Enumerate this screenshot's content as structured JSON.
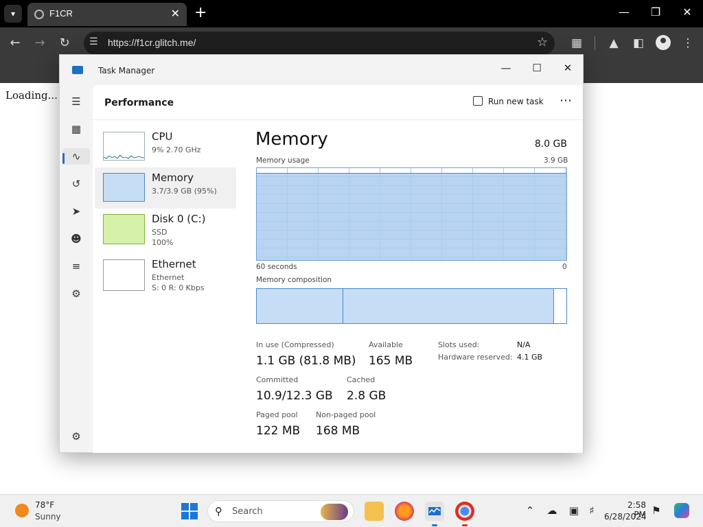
{
  "browser": {
    "tab_title": "F1CR",
    "url": "https://f1cr.glitch.me/",
    "page_text": "Loading... T"
  },
  "task_manager": {
    "title": "Task Manager",
    "section": "Performance",
    "run_new_task": "Run new task",
    "devices": [
      {
        "name": "CPU",
        "sub1": "9%  2.70 GHz",
        "sub2": ""
      },
      {
        "name": "Memory",
        "sub1": "3.7/3.9 GB (95%)",
        "sub2": ""
      },
      {
        "name": "Disk 0 (C:)",
        "sub1": "SSD",
        "sub2": "100%"
      },
      {
        "name": "Ethernet",
        "sub1": "Ethernet",
        "sub2": "S: 0 R: 0 Kbps"
      }
    ],
    "memory": {
      "heading": "Memory",
      "total": "8.0 GB",
      "usage_label": "Memory usage",
      "usage_max": "3.9 GB",
      "time_left": "60 seconds",
      "time_right": "0",
      "usage_fraction": 0.95,
      "composition_label": "Memory composition",
      "composition_segments": [
        0.28,
        0.68,
        0.04
      ],
      "stats": {
        "in_use_label": "In use (Compressed)",
        "in_use_value": "1.1 GB (81.8 MB)",
        "available_label": "Available",
        "available_value": "165 MB",
        "committed_label": "Committed",
        "committed_value": "10.9/12.3 GB",
        "cached_label": "Cached",
        "cached_value": "2.8 GB",
        "paged_label": "Paged pool",
        "paged_value": "122 MB",
        "nonpaged_label": "Non-paged pool",
        "nonpaged_value": "168 MB",
        "slots_label": "Slots used:",
        "slots_value": "N/A",
        "hw_label": "Hardware reserved:",
        "hw_value": "4.1 GB"
      }
    }
  },
  "taskbar": {
    "weather_temp": "78°F",
    "weather_desc": "Sunny",
    "search_placeholder": "Search",
    "time": "2:58 PM",
    "date": "6/28/2024"
  },
  "colors": {
    "accent": "#1f6fc4",
    "memory_fill": "#c6ddf6",
    "disk_fill": "#d6f2a8"
  }
}
